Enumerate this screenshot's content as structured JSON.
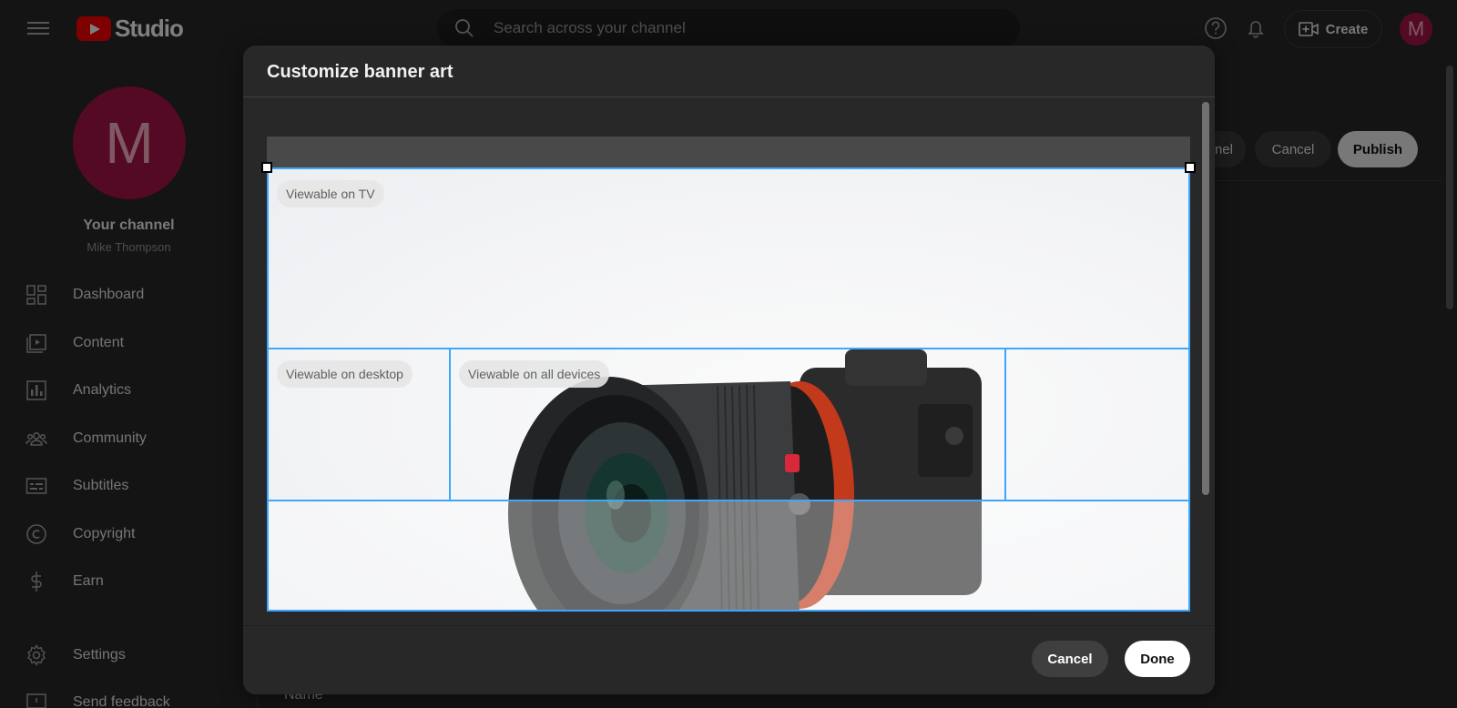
{
  "app": {
    "brand": "Studio"
  },
  "search": {
    "placeholder": "Search across your channel"
  },
  "header": {
    "create_label": "Create",
    "avatar_initial": "M"
  },
  "sidebar": {
    "avatar_initial": "M",
    "channel_title": "Your channel",
    "channel_name": "Mike Thompson",
    "items": [
      {
        "label": "Dashboard",
        "icon": "dashboard-icon"
      },
      {
        "label": "Content",
        "icon": "content-icon"
      },
      {
        "label": "Analytics",
        "icon": "analytics-icon"
      },
      {
        "label": "Community",
        "icon": "community-icon"
      },
      {
        "label": "Subtitles",
        "icon": "subtitles-icon"
      },
      {
        "label": "Copyright",
        "icon": "copyright-icon"
      },
      {
        "label": "Earn",
        "icon": "earn-icon"
      },
      {
        "label": "Settings",
        "icon": "settings-icon"
      },
      {
        "label": "Send feedback",
        "icon": "feedback-icon"
      }
    ]
  },
  "background_page": {
    "partial_button": "nel",
    "cancel_label": "Cancel",
    "publish_label": "Publish",
    "name_label": "Name"
  },
  "dialog": {
    "title": "Customize banner art",
    "zones": {
      "tv": "Viewable on TV",
      "desktop": "Viewable on desktop",
      "all_devices": "Viewable on all devices"
    },
    "cancel_label": "Cancel",
    "done_label": "Done"
  },
  "colors": {
    "accent": "#3ea6ff",
    "brand_red": "#ff0000",
    "avatar": "#a8154a",
    "surface": "#282828"
  }
}
